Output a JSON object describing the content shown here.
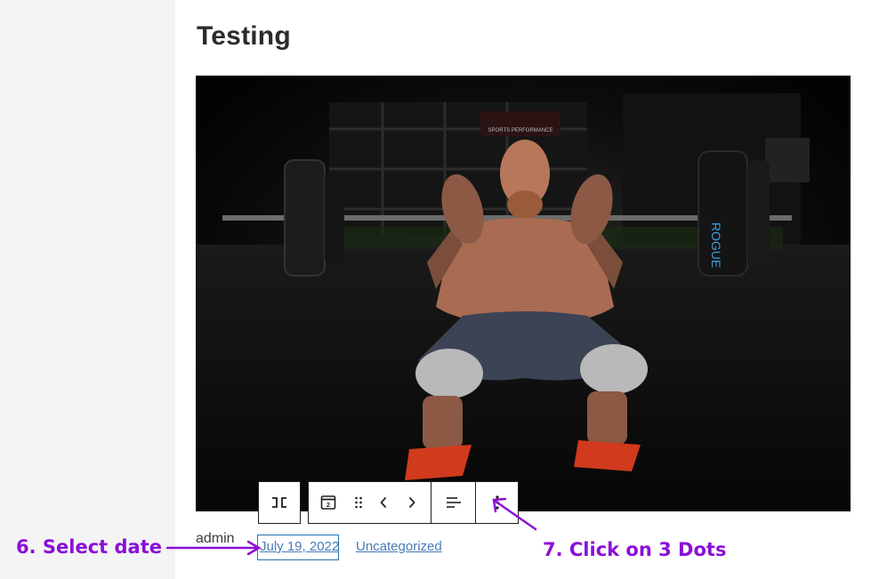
{
  "post": {
    "title": "Testing",
    "author": "admin",
    "date": "July 19, 2022",
    "category": "Uncategorized"
  },
  "image": {
    "banner_text": "SPORTS PERFORMANCE",
    "plate_text": "ROGUE"
  },
  "toolbar": {
    "transform_icon": "transform-block-icon",
    "block_icon": "post-date-block-icon",
    "block_icon_number": "2",
    "drag_icon": "drag-handle-icon",
    "move_left_icon": "chevron-left-icon",
    "move_right_icon": "chevron-right-icon",
    "align_icon": "align-left-icon",
    "more_icon": "more-options-icon"
  },
  "annotations": {
    "step6": "6. Select date",
    "step7": "7. Click on 3 Dots",
    "color": "#8a0fd8"
  }
}
